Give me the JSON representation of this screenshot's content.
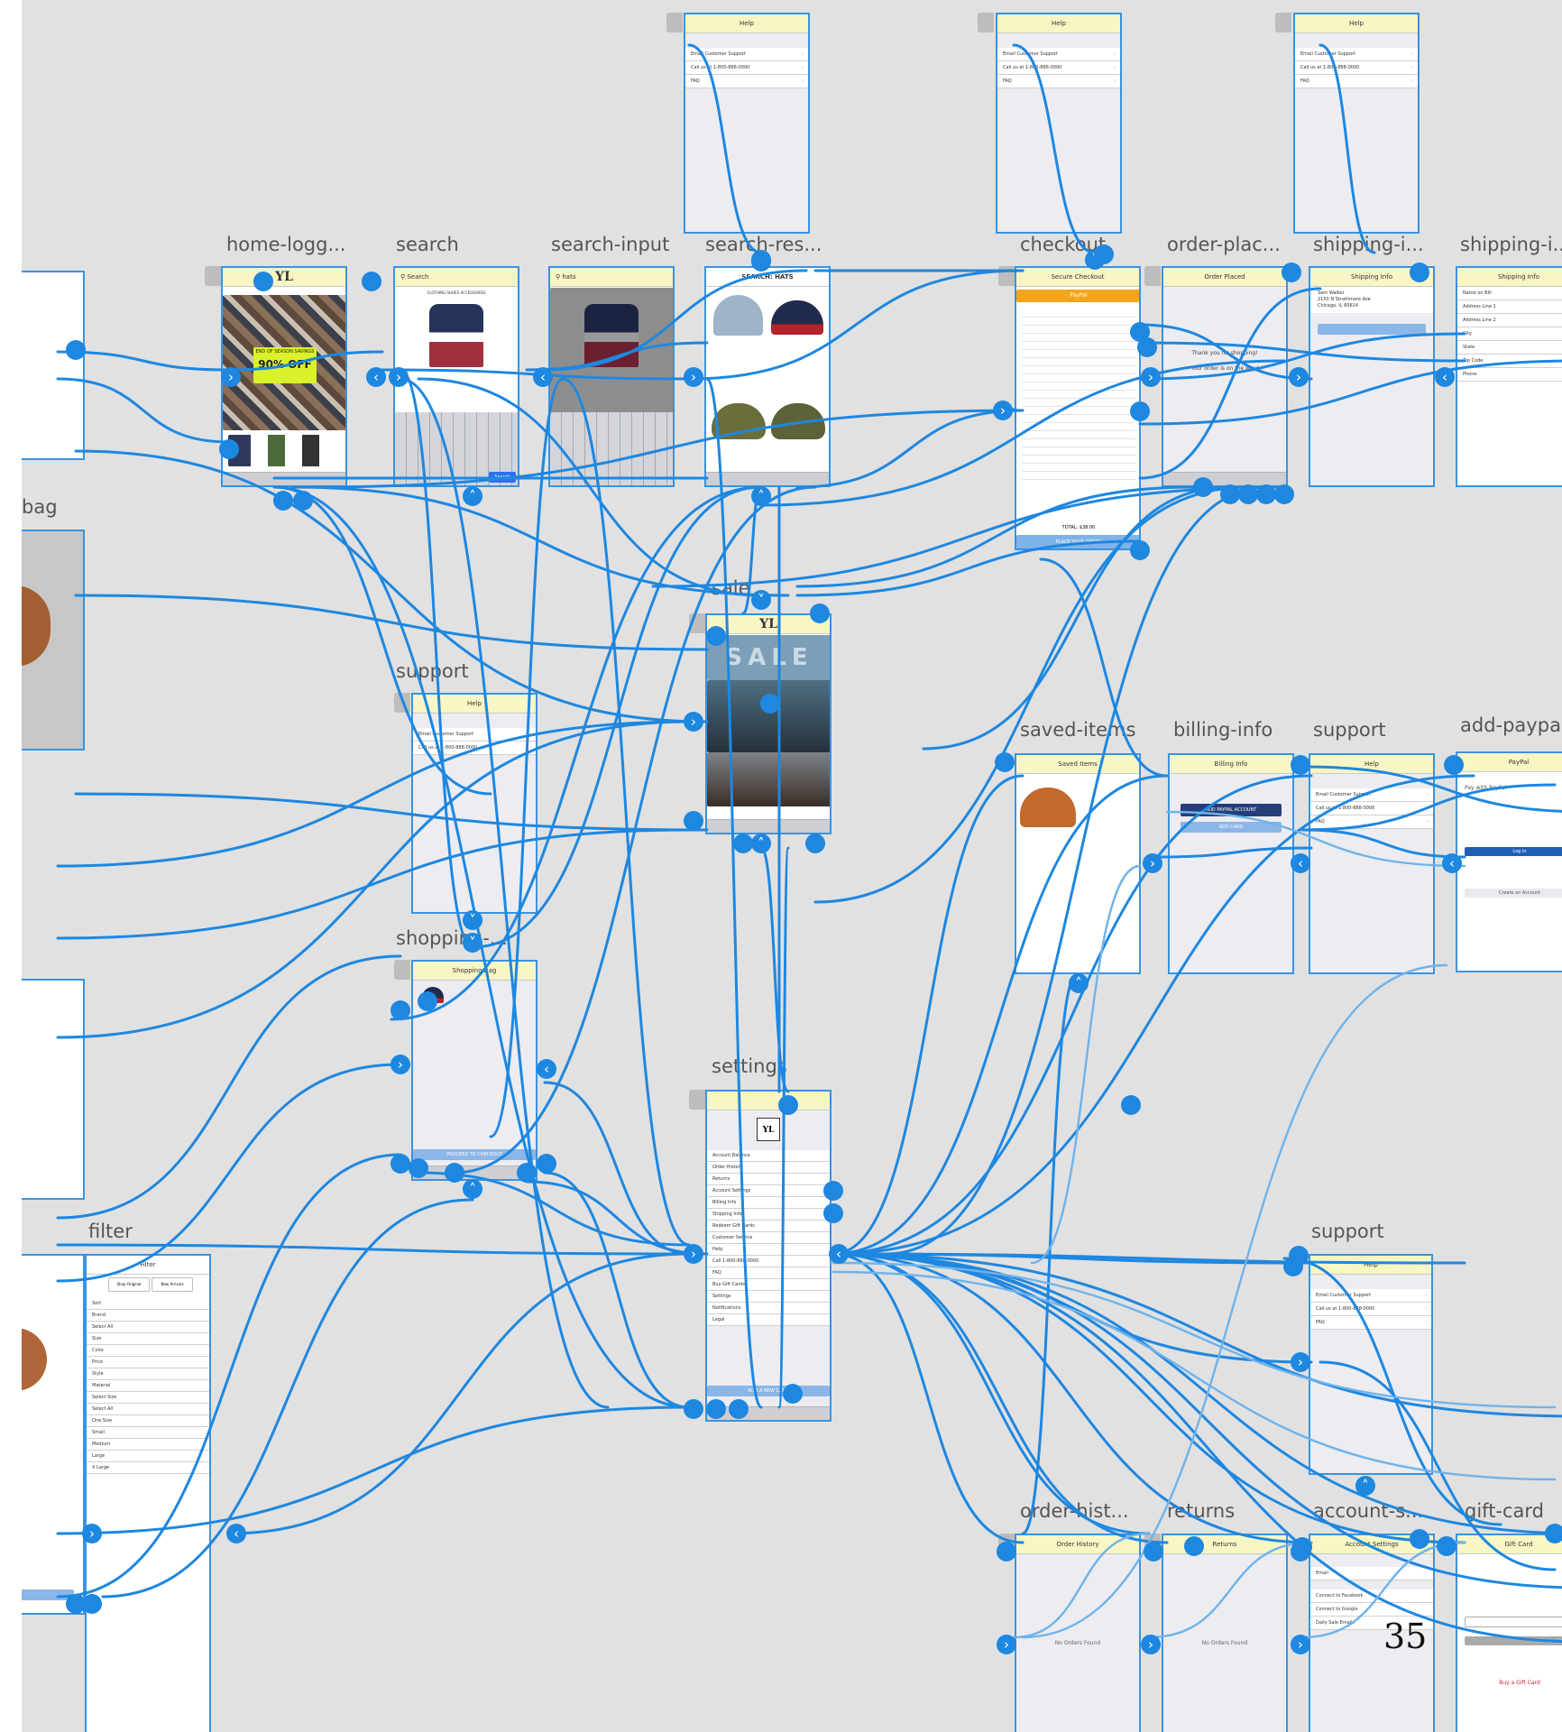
{
  "canvas": {
    "background": "#e1e1e1",
    "wire_color": "#1e87e0",
    "wire_color_faded": "#6fb3ea",
    "artboard_header_color": "#f7f6c4",
    "page_number": "35"
  },
  "artboards": {
    "home": {
      "label": "home-logg...",
      "logo": "YL",
      "promo_top": "END OF SEASON SAVINGS",
      "promo": "90% OFF"
    },
    "search": {
      "label": "search",
      "placeholder": "Search",
      "categories": "CLOTHING  SHOES  ACCESSORIES",
      "key_space": "space",
      "key_search": "Search"
    },
    "search_input": {
      "label": "search-input",
      "placeholder": "hats"
    },
    "search_results": {
      "label": "search-res...",
      "title": "SEARCH: HATS"
    },
    "checkout": {
      "label": "checkout",
      "title": "Secure Checkout",
      "paypal": "PayPal",
      "total": "TOTAL: $38.00",
      "cta": "PLACE YOUR ORDER"
    },
    "order_placed": {
      "label": "order-plac...",
      "title": "Order Placed",
      "line1": "Thank you for shopping!",
      "line2": "Your order is on the way!"
    },
    "shipping_info_1": {
      "label": "shipping-i...",
      "title": "Shipping Info"
    },
    "shipping_info_2": {
      "label": "shipping-i...",
      "title": "Shipping Info"
    },
    "help_top_1": {
      "title": "Help"
    },
    "help_top_2": {
      "title": "Help"
    },
    "help_top_3": {
      "title": "Help"
    },
    "bag_partial": {
      "label": "bag"
    },
    "sale": {
      "label": "sale",
      "logo": "YL",
      "banner": "SALE"
    },
    "support_1": {
      "label": "support",
      "title": "Help"
    },
    "shopping_bag": {
      "label": "shopping-...",
      "title": "Shopping Bag",
      "cta": "PROCEED TO CHECKOUT"
    },
    "saved_items": {
      "label": "saved-items",
      "title": "Saved Items"
    },
    "billing_info": {
      "label": "billing-info",
      "title": "Billing Info",
      "btn1": "ADD PAYPAL ACCOUNT",
      "btn2": "ADD CARD"
    },
    "support_2": {
      "label": "support",
      "title": "Help"
    },
    "add_paypal": {
      "label": "add-paypal",
      "title": "PayPal",
      "heading": "Pay with PayPal",
      "login": "Log In",
      "create": "Create an Account"
    },
    "settings": {
      "label": "settings",
      "logo": "YL",
      "cta": "ADD A NEW CARD"
    },
    "filter": {
      "label": "filter",
      "title": "Filter",
      "chip1": "Shop Original",
      "chip2": "New Arrivals",
      "select": "Select Size"
    },
    "support_3": {
      "label": "support",
      "title": "Help"
    },
    "order_history": {
      "label": "order-hist...",
      "title": "Order History",
      "empty": "No Orders Found"
    },
    "returns": {
      "label": "returns",
      "title": "Returns",
      "empty": "No Orders Found"
    },
    "account": {
      "label": "account-s...",
      "title": "Account Settings"
    },
    "gift_card": {
      "label": "gift-card",
      "title": "Gift Card",
      "link": "Buy a Gift Card"
    }
  },
  "help_rows": [
    "Email Customer Support",
    "Call us at 1-800-888-0000",
    "FAQ"
  ],
  "settings_rows": [
    "Account Balance",
    "Order History",
    "Returns",
    "Account Settings",
    "Billing Info",
    "Shipping Info",
    "Redeem Gift Cards",
    "Customer Service",
    "Help",
    "Call 1-800-888-0000",
    "FAQ",
    "Buy Gift Cards",
    "Settings",
    "Notifications",
    "Legal"
  ],
  "filter_rows": [
    "Sort",
    "Brand",
    "Select All",
    "Size",
    "Color",
    "Price",
    "Style",
    "Material",
    "Select Size",
    "Select All",
    "One Size",
    "Small",
    "Medium",
    "Large",
    "X Large"
  ],
  "account_rows": [
    "Email",
    "Connect to Facebook",
    "Connect to Google",
    "Daily Sale Emails"
  ],
  "shipping_rows": [
    "Sam Walker",
    "2150 N Strathmore Ave",
    "Chicago, IL 60614"
  ],
  "shipping_form_rows": [
    "Name on Bill",
    "Address Line 1",
    "Address Line 2",
    "City",
    "State",
    "Zip Code",
    "Phone"
  ]
}
